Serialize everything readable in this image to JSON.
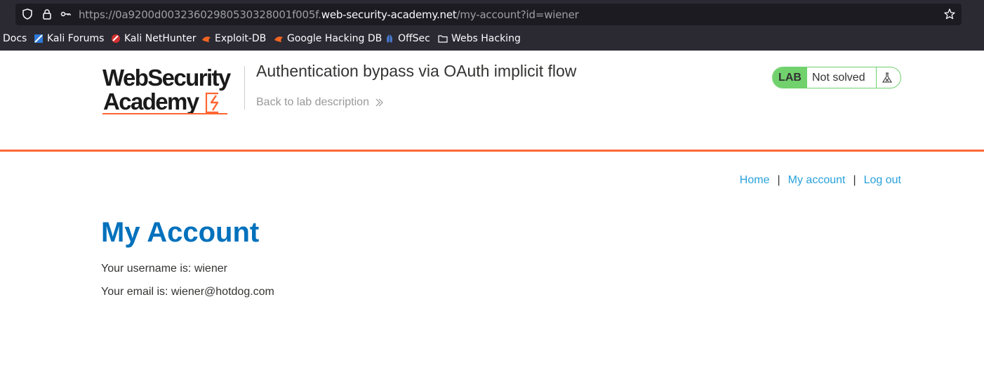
{
  "browser": {
    "url_prefix": "https://0a9200d0032360298053032800 1f005f.",
    "url_prefix_clean": "https://0a9200d003236029805303280 01f005f.",
    "url_scheme_id": "https://0a9200d00323602980530328001f005f.",
    "url_domain": "web-security-academy.net",
    "url_path": "/my-account?id=wiener",
    "bookmarks": [
      {
        "label": "Docs",
        "icon": "none"
      },
      {
        "label": "Kali Forums",
        "icon": "kali-forums-icon"
      },
      {
        "label": "Kali NetHunter",
        "icon": "kali-nethunter-icon"
      },
      {
        "label": "Exploit-DB",
        "icon": "exploit-db-icon"
      },
      {
        "label": "Google Hacking DB",
        "icon": "ghdb-icon"
      },
      {
        "label": "OffSec",
        "icon": "offsec-icon"
      },
      {
        "label": "Webs Hacking",
        "icon": "folder-icon"
      }
    ]
  },
  "header": {
    "logo_line1": "WebSecurity",
    "logo_line2": "Academy",
    "lab_title": "Authentication bypass via OAuth implicit flow",
    "back_link": "Back to lab description",
    "lab_badge": "LAB",
    "lab_state": "Not solved",
    "accent_color": "#ff6633",
    "status_color": "#70d16d"
  },
  "nav": {
    "home": "Home",
    "separator": "|",
    "my_account": "My account",
    "log_out": "Log out"
  },
  "main": {
    "title": "My Account",
    "username_line": "Your username is: wiener",
    "email_line": "Your email is: wiener@hotdog.com"
  }
}
